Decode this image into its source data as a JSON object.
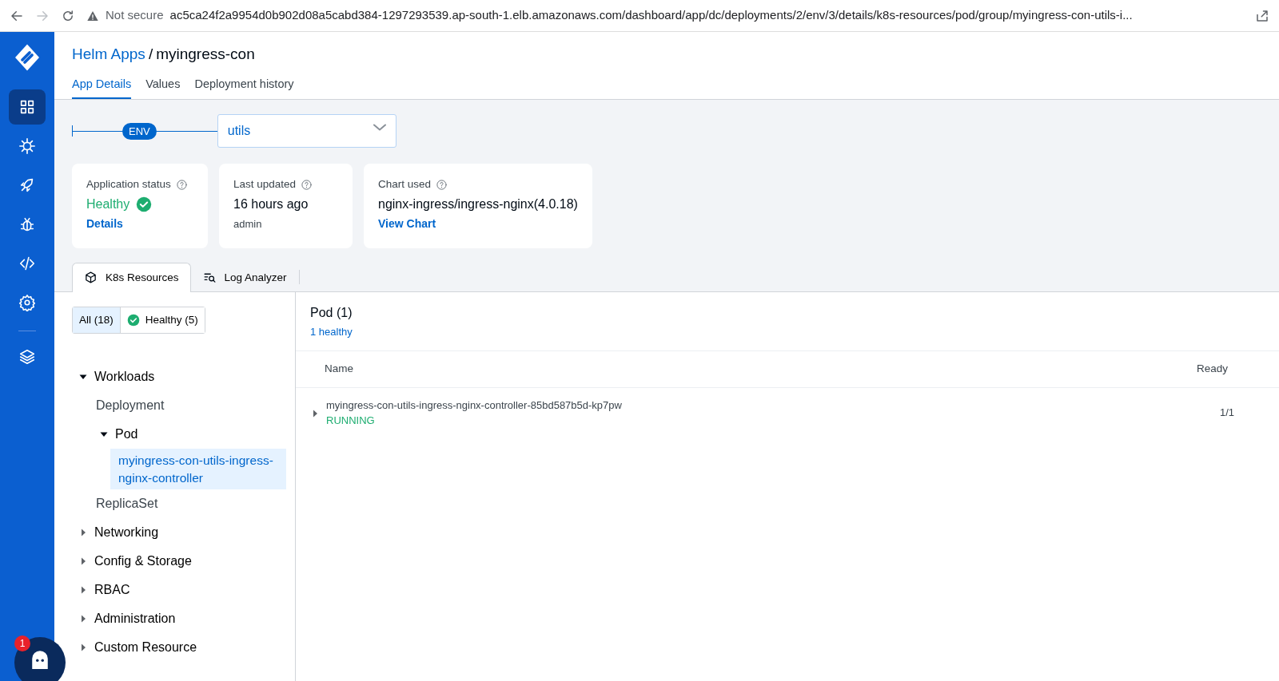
{
  "browser": {
    "security": "Not secure",
    "url": "ac5ca24f2a9954d0b902d08a5cabd384-1297293539.ap-south-1.elb.amazonaws.com/dashboard/app/dc/deployments/2/env/3/details/k8s-resources/pod/group/myingress-con-utils-i..."
  },
  "sidebar": {
    "items": [
      {
        "kind": "grid",
        "selected": true
      },
      {
        "kind": "helm",
        "selected": false
      },
      {
        "kind": "rocket",
        "selected": false
      },
      {
        "kind": "bug",
        "selected": false
      },
      {
        "kind": "code",
        "selected": false
      },
      {
        "kind": "gear",
        "selected": false
      },
      {
        "kind": "layers",
        "selected": false
      }
    ],
    "notification_count": "1"
  },
  "breadcrumb": {
    "parent": "Helm Apps",
    "separator": "/",
    "current": "myingress-con"
  },
  "tabs": [
    {
      "label": "App Details",
      "selected": true
    },
    {
      "label": "Values",
      "selected": false
    },
    {
      "label": "Deployment history",
      "selected": false
    }
  ],
  "env": {
    "badge": "ENV",
    "value": "utils"
  },
  "cards": [
    {
      "title": "Application status",
      "value": "Healthy",
      "kind": "status",
      "link": "Details"
    },
    {
      "title": "Last updated",
      "value": "16 hours ago",
      "kind": "time",
      "sub": "admin"
    },
    {
      "title": "Chart used",
      "value": "nginx-ingress/ingress-nginx(4.0.18)",
      "kind": "chart",
      "link": "View Chart"
    }
  ],
  "resource_tabs": [
    {
      "label": "K8s Resources",
      "kind": "cube",
      "selected": true
    },
    {
      "label": "Log Analyzer",
      "kind": "log-search",
      "selected": false
    }
  ],
  "filters": [
    {
      "label": "All (18)",
      "healthy": false,
      "selected": true
    },
    {
      "label": "Healthy (5)",
      "healthy": true,
      "selected": false
    }
  ],
  "tree": [
    {
      "label": "Workloads",
      "expanded": true,
      "children": [
        {
          "label": "Deployment"
        },
        {
          "label": "Pod",
          "expanded": true,
          "children": [
            {
              "label": "myingress-con-utils-ingress-nginx-controller",
              "selected": true
            }
          ]
        },
        {
          "label": "ReplicaSet"
        }
      ]
    },
    {
      "label": "Networking",
      "expanded": false
    },
    {
      "label": "Config & Storage",
      "expanded": false
    },
    {
      "label": "RBAC",
      "expanded": false
    },
    {
      "label": "Administration",
      "expanded": false
    },
    {
      "label": "Custom Resource",
      "expanded": false
    }
  ],
  "panel": {
    "title": "Pod (1)",
    "subtitle": "1 healthy",
    "columns": [
      "Name",
      "Ready"
    ],
    "rows": [
      {
        "name": "myingress-con-utils-ingress-nginx-controller-85bd587b5d-kp7pw",
        "status": "RUNNING",
        "ready": "1/1",
        "expanded": false
      }
    ]
  }
}
